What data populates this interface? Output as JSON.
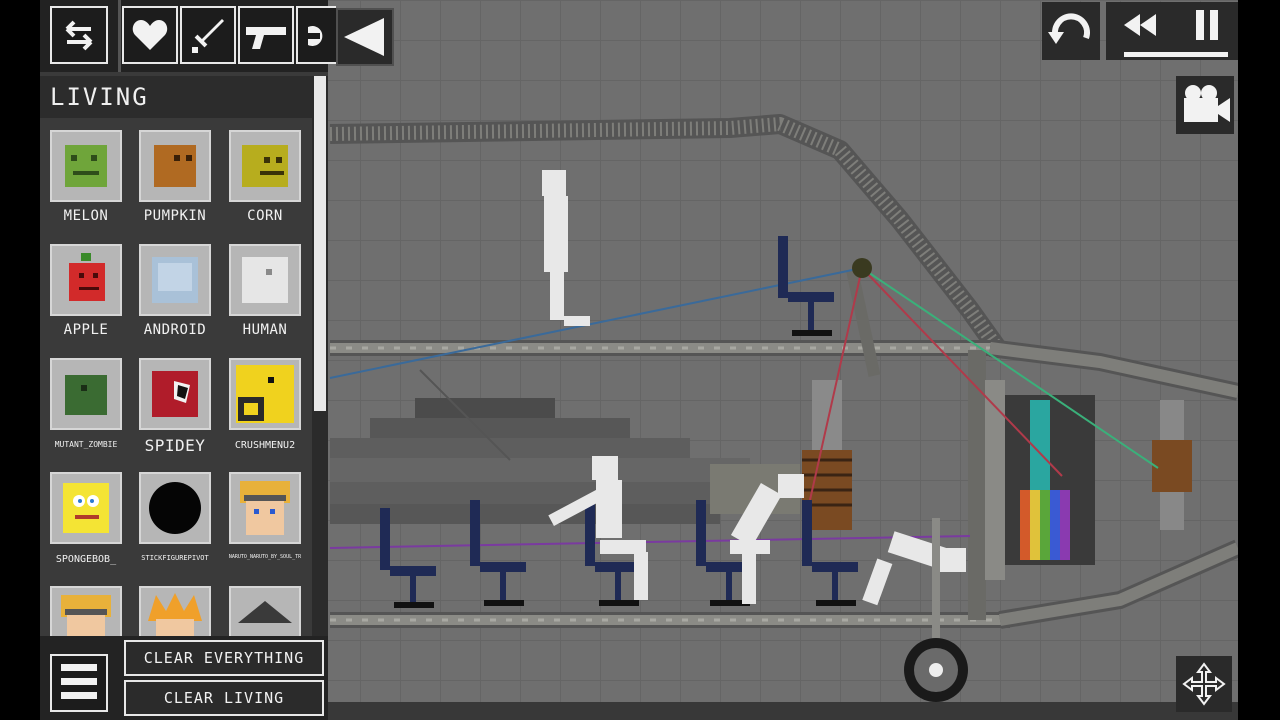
{
  "sidebar": {
    "tabs": [
      {
        "name": "swap-icon"
      },
      {
        "name": "heart-icon"
      },
      {
        "name": "sword-icon"
      },
      {
        "name": "gun-icon"
      },
      {
        "name": "explosive-icon"
      }
    ],
    "category_title": "LIVING",
    "items": [
      {
        "label": "MELON",
        "color": "#6fa53a"
      },
      {
        "label": "PUMPKIN",
        "color": "#b06a22"
      },
      {
        "label": "CORN",
        "color": "#b7ad1e"
      },
      {
        "label": "APPLE",
        "color": "#d22a2a"
      },
      {
        "label": "ANDROID",
        "color": "#a9c1d8"
      },
      {
        "label": "HUMAN",
        "color": "#e6e6e6"
      },
      {
        "label": "MUTANT_ZOMBIE",
        "color": "#3a6b32"
      },
      {
        "label": "SPIDEY",
        "color": "#b01c2a"
      },
      {
        "label": "CRUSHMENU2",
        "color": "#f0d21e"
      },
      {
        "label": "SPONGEBOB_",
        "color": "#f4e434"
      },
      {
        "label": "STICKFIGUREPIVOT",
        "color": "#050505"
      },
      {
        "label": "NARUTO_NARUTO_BY_SOUL_TR",
        "color": "#e8b13a"
      },
      {
        "label": "",
        "color": "#e8b13a"
      },
      {
        "label": "",
        "color": "#f0a02a"
      },
      {
        "label": "",
        "color": "#3a3a3a"
      }
    ],
    "menu_button": "menu-icon",
    "clear_everything": "CLEAR EVERYTHING",
    "clear_living": "CLEAR LIVING"
  },
  "controls": {
    "collapse": "collapse-arrow-icon",
    "undo": "undo-icon",
    "rewind": "rewind-icon",
    "pause": "pause-icon",
    "camera": "camera-icon",
    "move": "move-icon"
  },
  "colors": {
    "panel_bg": "#3a3a3a",
    "game_bg": "#6f6f6f",
    "button_border": "#e8e8e8",
    "button_bg": "#2a2a2a"
  }
}
